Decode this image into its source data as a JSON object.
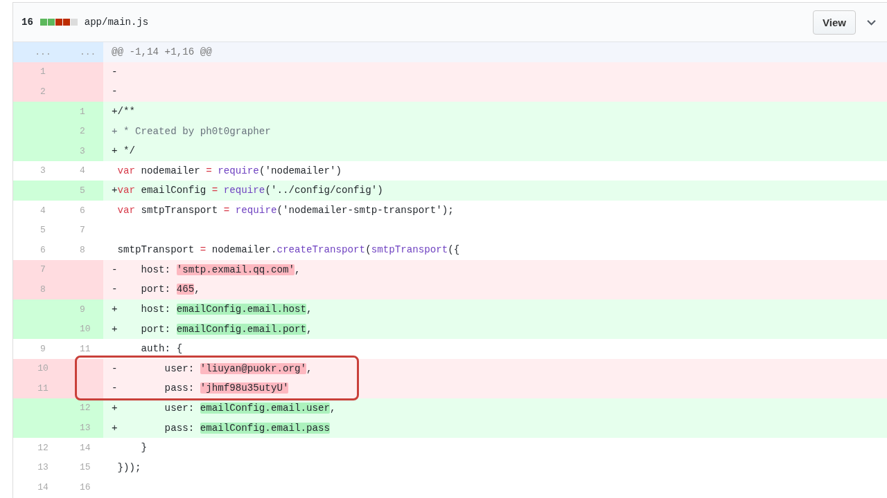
{
  "file_header": {
    "changes": "16",
    "diffstat": [
      {
        "kind": "add"
      },
      {
        "kind": "add"
      },
      {
        "kind": "del"
      },
      {
        "kind": "del"
      },
      {
        "kind": "neutral"
      }
    ],
    "path": "app/main.js",
    "view_button": "View"
  },
  "lines": [
    {
      "kind": "hunk",
      "old": "...",
      "new": "...",
      "boxed": false,
      "parts": [
        {
          "text": "@@ -1,14 +1,16 @@",
          "kind": "plain"
        }
      ]
    },
    {
      "kind": "del",
      "old": "1",
      "boxed": false,
      "parts": [
        {
          "text": "-",
          "kind": "plain"
        }
      ]
    },
    {
      "kind": "del",
      "old": "2",
      "boxed": false,
      "parts": [
        {
          "text": "-",
          "kind": "plain"
        }
      ]
    },
    {
      "kind": "add",
      "new": "1",
      "boxed": false,
      "parts": [
        {
          "text": "+/**",
          "kind": "plain"
        }
      ]
    },
    {
      "kind": "add",
      "new": "2",
      "boxed": false,
      "parts": [
        {
          "text": "+ * Created by ph0t0grapher",
          "kind": "comment"
        }
      ]
    },
    {
      "kind": "add",
      "new": "3",
      "boxed": false,
      "parts": [
        {
          "text": "+ */",
          "kind": "plain"
        }
      ]
    },
    {
      "kind": "context",
      "old": "3",
      "new": "4",
      "boxed": false,
      "parts": [
        {
          "text": " var",
          "kind": "keyword"
        },
        {
          "text": " nodemailer ",
          "kind": "plain"
        },
        {
          "text": "= ",
          "kind": "keyword"
        },
        {
          "text": "require",
          "kind": "func"
        },
        {
          "text": "('nodemailer')",
          "kind": "plain"
        }
      ]
    },
    {
      "kind": "add",
      "new": "5",
      "boxed": false,
      "parts": [
        {
          "text": "+",
          "kind": "plain"
        },
        {
          "text": "var",
          "kind": "keyword"
        },
        {
          "text": " emailConfig ",
          "kind": "plain"
        },
        {
          "text": "= ",
          "kind": "keyword"
        },
        {
          "text": "require",
          "kind": "func"
        },
        {
          "text": "('../config/config')",
          "kind": "plain"
        }
      ]
    },
    {
      "kind": "context",
      "old": "4",
      "new": "6",
      "boxed": false,
      "parts": [
        {
          "text": " var",
          "kind": "keyword"
        },
        {
          "text": " smtpTransport ",
          "kind": "plain"
        },
        {
          "text": "= ",
          "kind": "keyword"
        },
        {
          "text": "require",
          "kind": "func"
        },
        {
          "text": "('nodemailer-smtp-transport');",
          "kind": "plain"
        }
      ]
    },
    {
      "kind": "context",
      "old": "5",
      "new": "7",
      "boxed": false
    },
    {
      "kind": "context",
      "old": "6",
      "new": "8",
      "boxed": false,
      "parts": [
        {
          "text": " smtpTransport ",
          "kind": "plain"
        },
        {
          "text": "=",
          "kind": "keyword"
        },
        {
          "text": " nodemailer.",
          "kind": "plain"
        },
        {
          "text": "createTransport",
          "kind": "func"
        },
        {
          "text": "(",
          "kind": "plain"
        },
        {
          "text": "smtpTransport",
          "kind": "func"
        },
        {
          "text": "({",
          "kind": "plain"
        }
      ]
    },
    {
      "kind": "del",
      "old": "7",
      "boxed": false,
      "parts": [
        {
          "text": "-    host: ",
          "kind": "plain"
        },
        {
          "text": "'smtp.exmail.qq.com'",
          "kind": "changed"
        },
        {
          "text": ",",
          "kind": "plain"
        }
      ]
    },
    {
      "kind": "del",
      "old": "8",
      "boxed": false,
      "parts": [
        {
          "text": "-    port: ",
          "kind": "plain"
        },
        {
          "text": "465",
          "kind": "changed"
        },
        {
          "text": ",",
          "kind": "plain"
        }
      ]
    },
    {
      "kind": "add",
      "new": "9",
      "boxed": false,
      "parts": [
        {
          "text": "+    host: ",
          "kind": "plain"
        },
        {
          "text": "emailConfig.email.host",
          "kind": "changed"
        },
        {
          "text": ",",
          "kind": "plain"
        }
      ]
    },
    {
      "kind": "add",
      "new": "10",
      "boxed": false,
      "parts": [
        {
          "text": "+    port: ",
          "kind": "plain"
        },
        {
          "text": "emailConfig.email.port",
          "kind": "changed"
        },
        {
          "text": ",",
          "kind": "plain"
        }
      ]
    },
    {
      "kind": "context",
      "old": "9",
      "new": "11",
      "boxed": false,
      "parts": [
        {
          "text": "     auth: {",
          "kind": "plain"
        }
      ]
    },
    {
      "kind": "del",
      "old": "10",
      "boxed": true,
      "parts": [
        {
          "text": "-        user: ",
          "kind": "plain"
        },
        {
          "text": "'liuyan@puokr.org'",
          "kind": "changed"
        },
        {
          "text": ",",
          "kind": "plain"
        }
      ]
    },
    {
      "kind": "del",
      "old": "11",
      "boxed": true,
      "parts": [
        {
          "text": "-        pass: ",
          "kind": "plain"
        },
        {
          "text": "'jhmf98u35utyU'",
          "kind": "changed"
        }
      ]
    },
    {
      "kind": "add",
      "new": "12",
      "boxed": false,
      "parts": [
        {
          "text": "+        user: ",
          "kind": "plain"
        },
        {
          "text": "emailConfig.email.user",
          "kind": "changed"
        },
        {
          "text": ",",
          "kind": "plain"
        }
      ]
    },
    {
      "kind": "add",
      "new": "13",
      "boxed": false,
      "parts": [
        {
          "text": "+        pass: ",
          "kind": "plain"
        },
        {
          "text": "emailConfig.email.pass",
          "kind": "changed"
        }
      ]
    },
    {
      "kind": "context",
      "old": "12",
      "new": "14",
      "boxed": false,
      "parts": [
        {
          "text": "     }",
          "kind": "plain"
        }
      ]
    },
    {
      "kind": "context",
      "old": "13",
      "new": "15",
      "boxed": false,
      "parts": [
        {
          "text": " }));",
          "kind": "plain"
        }
      ]
    },
    {
      "kind": "context",
      "old": "14",
      "new": "16",
      "boxed": false
    }
  ]
}
